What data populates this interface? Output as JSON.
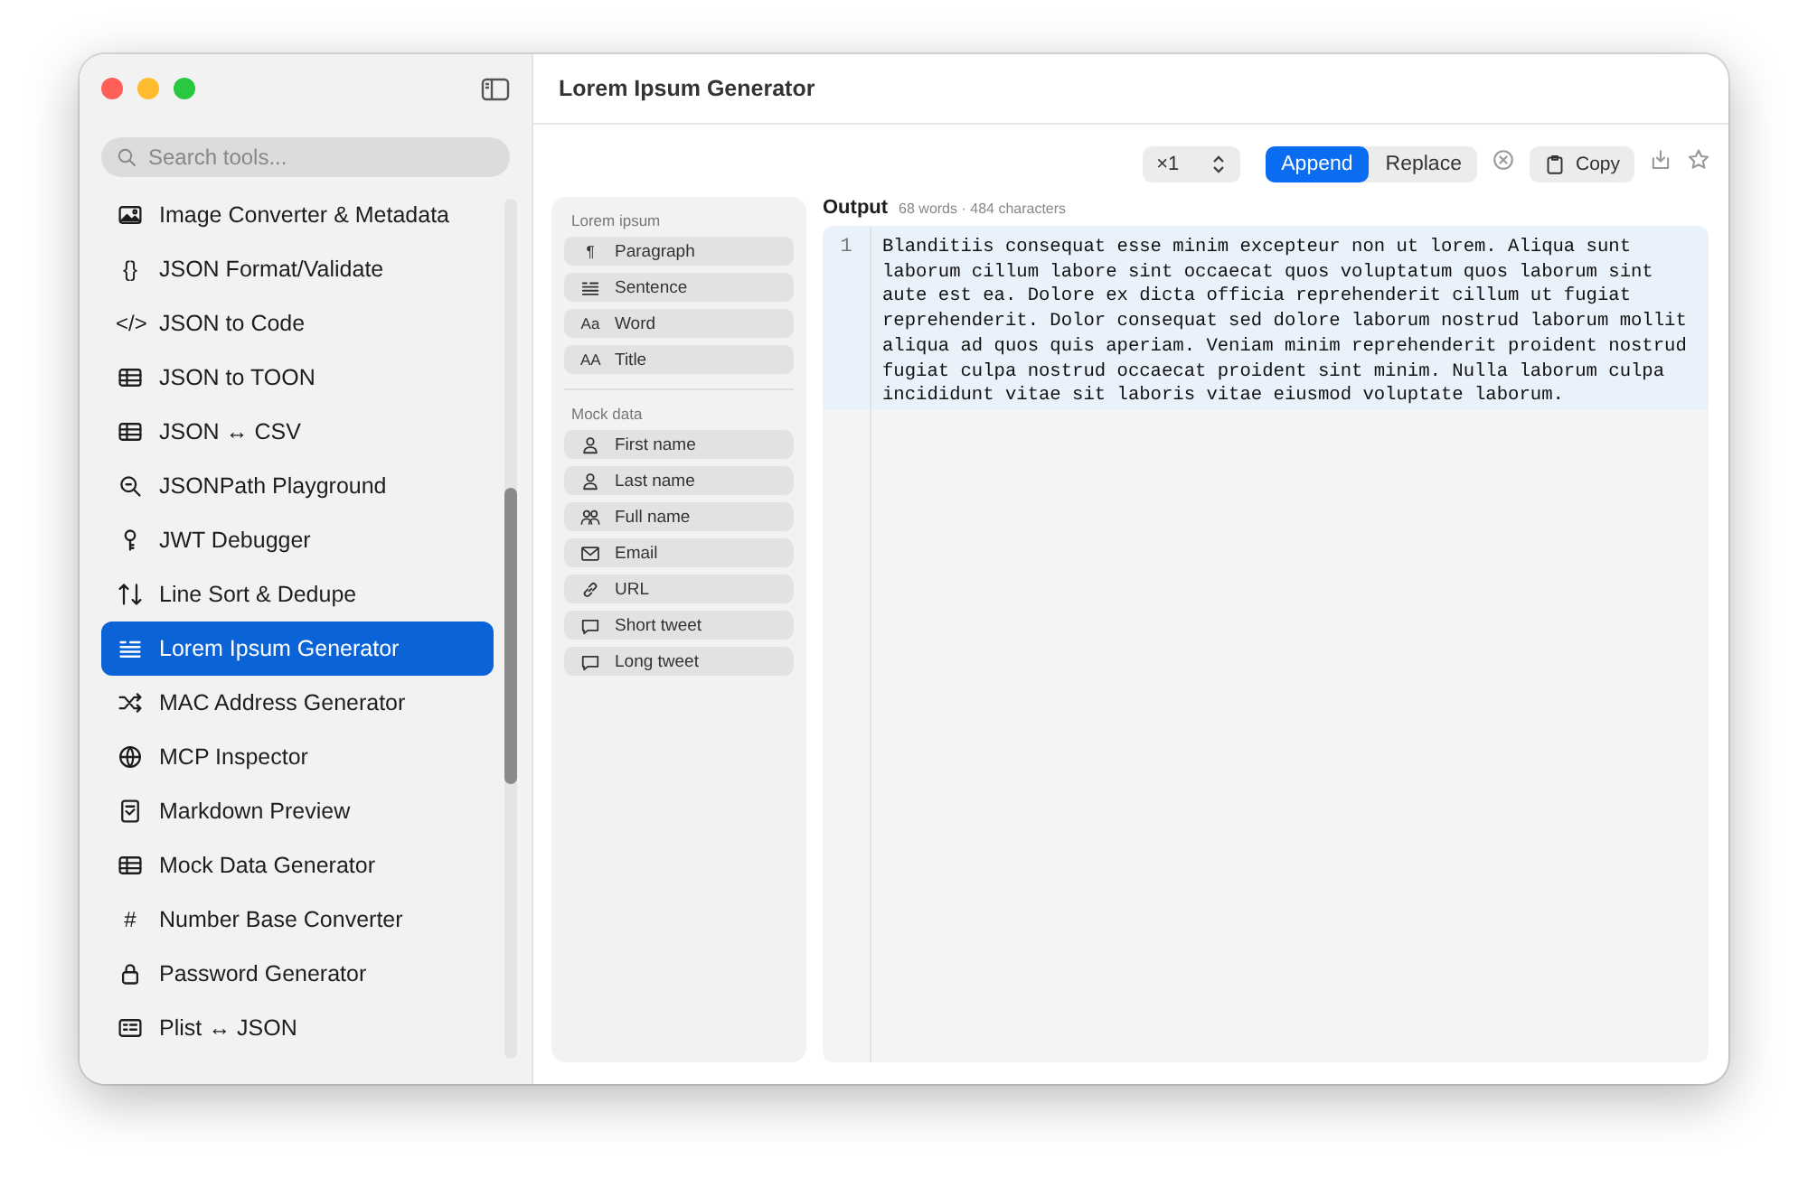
{
  "window": {
    "title": "Lorem Ipsum Generator"
  },
  "sidebar": {
    "search": {
      "placeholder": "Search tools..."
    },
    "items": [
      {
        "label": "Image Converter & Metadata",
        "selected": false
      },
      {
        "label": "JSON Format/Validate",
        "glyph": "{}",
        "selected": false
      },
      {
        "label": "JSON to Code",
        "glyph": "</>",
        "selected": false
      },
      {
        "label": "JSON to TOON",
        "selected": false
      },
      {
        "label": "JSON ↔ CSV",
        "selected": false
      },
      {
        "label": "JSONPath Playground",
        "selected": false
      },
      {
        "label": "JWT Debugger",
        "selected": false
      },
      {
        "label": "Line Sort & Dedupe",
        "selected": false
      },
      {
        "label": "Lorem Ipsum Generator",
        "selected": true
      },
      {
        "label": "MAC Address Generator",
        "selected": false
      },
      {
        "label": "MCP Inspector",
        "selected": false
      },
      {
        "label": "Markdown Preview",
        "selected": false
      },
      {
        "label": "Mock Data Generator",
        "selected": false
      },
      {
        "label": "Number Base Converter",
        "glyph": "#",
        "selected": false
      },
      {
        "label": "Password Generator",
        "selected": false
      },
      {
        "label": "Plist ↔ JSON",
        "selected": false
      }
    ]
  },
  "toolbar": {
    "count": "×1",
    "modes": [
      {
        "label": "Append",
        "selected": true
      },
      {
        "label": "Replace",
        "selected": false
      }
    ],
    "copy": "Copy"
  },
  "generators": [
    {
      "heading": "Lorem ipsum",
      "items": [
        {
          "label": "Paragraph",
          "glyph": "¶"
        },
        {
          "label": "Sentence"
        },
        {
          "label": "Word",
          "glyph": "Aa"
        },
        {
          "label": "Title",
          "glyph": "AA"
        }
      ]
    },
    {
      "heading": "Mock data",
      "items": [
        {
          "label": "First name"
        },
        {
          "label": "Last name"
        },
        {
          "label": "Full name"
        },
        {
          "label": "Email"
        },
        {
          "label": "URL"
        },
        {
          "label": "Short tweet"
        },
        {
          "label": "Long tweet"
        }
      ]
    }
  ],
  "output": {
    "title": "Output",
    "stats": "68 words · 484 characters",
    "lines": [
      {
        "number": "1",
        "text": "Blanditiis consequat esse minim excepteur non ut lorem. Aliqua sunt laborum cillum labore sint occaecat quos voluptatum quos laborum sint aute est ea. Dolore ex dicta officia reprehenderit cillum ut fugiat reprehenderit. Dolor consequat sed dolore laborum nostrud laborum mollit aliqua ad quos quis aperiam. Veniam minim reprehenderit proident nostrud fugiat culpa nostrud occaecat proident sint minim. Nulla laborum culpa incididunt vitae sit laboris vitae eiusmod voluptate laborum."
      }
    ]
  }
}
